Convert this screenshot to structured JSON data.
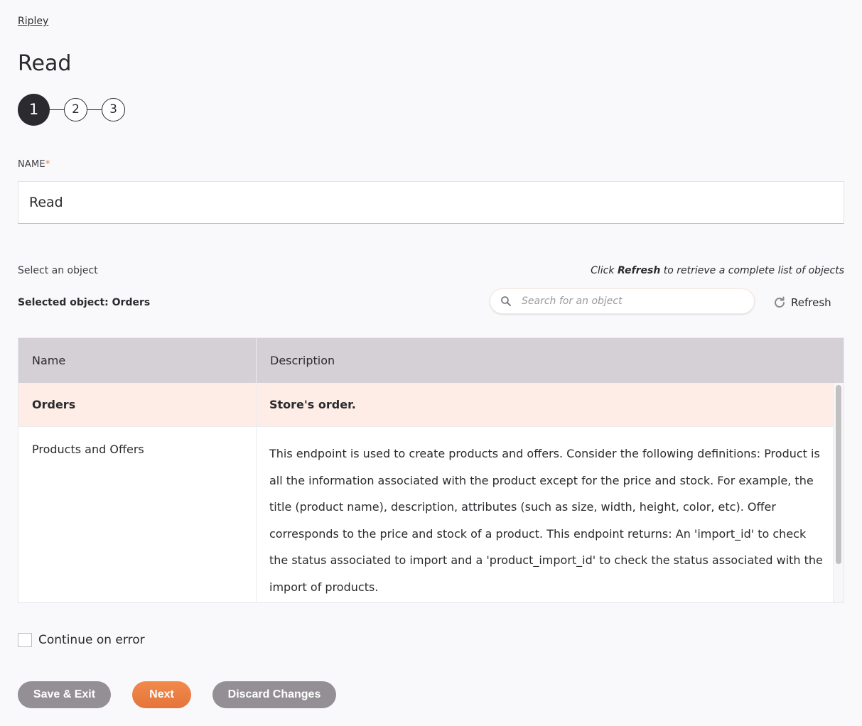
{
  "breadcrumb": "Ripley",
  "title": "Read",
  "stepper": {
    "steps": [
      "1",
      "2",
      "3"
    ],
    "current": 1
  },
  "name_field": {
    "label": "NAME",
    "required_marker": "*",
    "value": "Read"
  },
  "object_selection": {
    "label": "Select an object",
    "hint_prefix": "Click ",
    "hint_bold": "Refresh",
    "hint_suffix": " to retrieve a complete list of objects",
    "selected_text": "Selected object: Orders",
    "search_placeholder": "Search for an object",
    "refresh_label": "Refresh"
  },
  "table": {
    "columns": [
      "Name",
      "Description"
    ],
    "rows": [
      {
        "name": "Orders",
        "description": "Store's order.",
        "selected": true
      },
      {
        "name": "Products and Offers",
        "description": "This endpoint is used to create products and offers. Consider the following definitions: Product is all the information associated with the product except for the price and stock. For example, the title (product name), description, attributes (such as size, width, height, color, etc). Offer corresponds to the price and stock of a product. This endpoint returns: An 'import_id' to check the status associated to import and a 'product_import_id' to check the status associated with the import of products.",
        "selected": false
      }
    ]
  },
  "continue_on_error": {
    "label": "Continue on error",
    "checked": false
  },
  "buttons": {
    "save_exit": "Save & Exit",
    "next": "Next",
    "discard": "Discard Changes"
  },
  "colors": {
    "accent": "#ee7d3f",
    "selected_row": "#fdede6",
    "header_bg": "#d5d0d6",
    "button_gray": "#948f95",
    "dark": "#2b2a2e"
  }
}
